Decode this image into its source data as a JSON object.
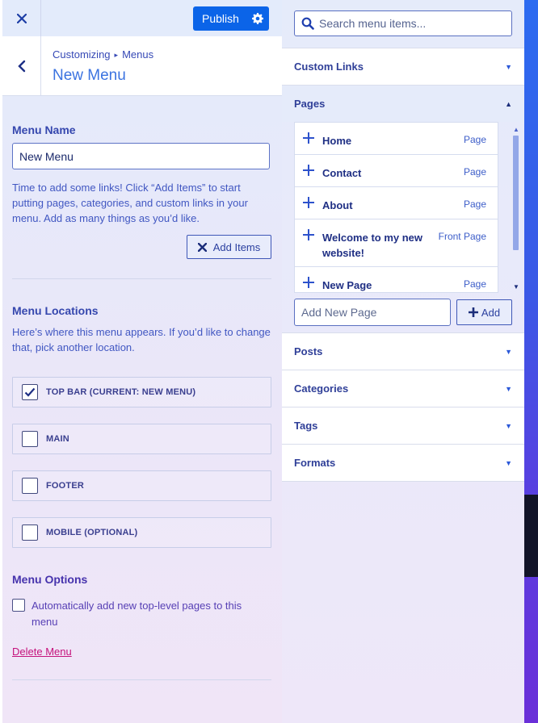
{
  "header": {
    "publish_label": "Publish",
    "breadcrumb": [
      "Customizing",
      "Menus"
    ],
    "title": "New Menu"
  },
  "menu_name": {
    "heading": "Menu Name",
    "value": "New Menu",
    "help": "Time to add some links! Click “Add Items” to start putting pages, categories, and custom links in your menu. Add as many things as you’d like.",
    "add_items_label": "Add Items"
  },
  "locations": {
    "heading": "Menu Locations",
    "help": "Here’s where this menu appears. If you’d like to change that, pick another location.",
    "items": [
      {
        "label": "TOP BAR (CURRENT: NEW MENU)",
        "checked": true
      },
      {
        "label": "MAIN",
        "checked": false
      },
      {
        "label": "FOOTER",
        "checked": false
      },
      {
        "label": "MOBILE (OPTIONAL)",
        "checked": false
      }
    ]
  },
  "options": {
    "heading": "Menu Options",
    "auto_add_label": "Automatically add new top-level pages to this menu",
    "auto_add_checked": false,
    "delete_label": "Delete Menu"
  },
  "panel": {
    "search_placeholder": "Search menu items...",
    "sections_top": [
      "Custom Links"
    ],
    "pages_heading": "Pages",
    "pages": [
      {
        "name": "Home",
        "type": "Page"
      },
      {
        "name": "Contact",
        "type": "Page"
      },
      {
        "name": "About",
        "type": "Page"
      },
      {
        "name": "Welcome to my new website!",
        "type": "Front Page"
      },
      {
        "name": "New Page",
        "type": "Page"
      }
    ],
    "add_page_placeholder": "Add New Page",
    "add_label": "Add",
    "sections_bottom": [
      "Posts",
      "Categories",
      "Tags",
      "Formats"
    ]
  },
  "colors": {
    "accent": "#0b64e8",
    "link_danger": "#c5127c",
    "text_primary": "#3547ae"
  },
  "icons": {
    "close": "close-icon",
    "settings": "gear-icon",
    "back": "chevron-left-icon",
    "search": "search-icon",
    "add": "plus-icon",
    "remove": "x-icon",
    "expand": "triangle-down-icon",
    "collapse": "triangle-up-icon"
  }
}
